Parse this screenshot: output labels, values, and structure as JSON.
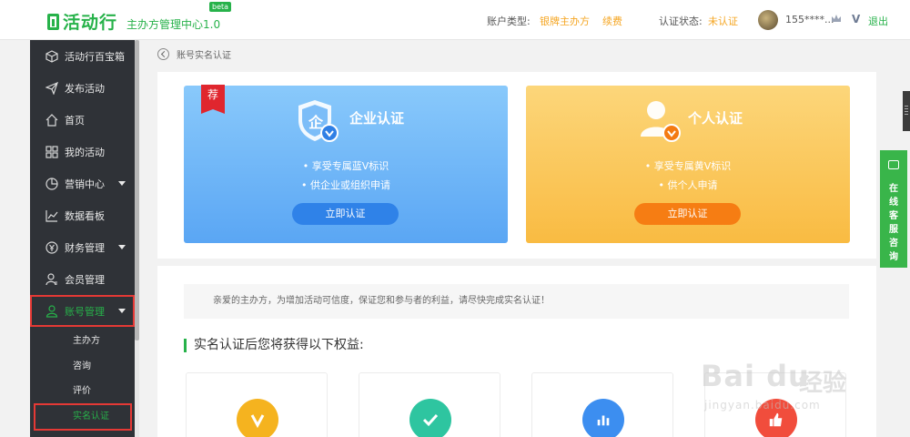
{
  "header": {
    "logo_name": "活动行",
    "logo_sub": "主办方管理中心1.0",
    "beta": "beta",
    "account_type_label": "账户类型:",
    "account_type_value": "银牌主办方",
    "renew": "续费",
    "verify_label": "认证状态:",
    "verify_value": "未认证",
    "phone": "155****...",
    "v_badge": "V",
    "logout": "退出"
  },
  "sidebar": {
    "items": [
      {
        "label": "活动行百宝箱",
        "icon": "cube-icon"
      },
      {
        "label": "发布活动",
        "icon": "paper-plane-icon"
      },
      {
        "label": "首页",
        "icon": "home-icon"
      },
      {
        "label": "我的活动",
        "icon": "grid-icon"
      },
      {
        "label": "营销中心",
        "icon": "pie-chart-icon"
      },
      {
        "label": "数据看板",
        "icon": "line-chart-icon"
      },
      {
        "label": "财务管理",
        "icon": "yen-icon"
      },
      {
        "label": "会员管理",
        "icon": "members-icon"
      },
      {
        "label": "账号管理",
        "icon": "user-icon"
      }
    ],
    "sub_items": [
      {
        "label": "主办方"
      },
      {
        "label": "咨询"
      },
      {
        "label": "评价"
      },
      {
        "label": "实名认证"
      }
    ]
  },
  "breadcrumb": {
    "label": "账号实名认证"
  },
  "cards": {
    "enterprise": {
      "badge": "荐",
      "title": "企业认证",
      "bullets": [
        "享受专属蓝V标识",
        "供企业或组织申请"
      ],
      "button": "立即认证"
    },
    "personal": {
      "title": "个人认证",
      "bullets": [
        "享受专属黄V标识",
        "供个人申请"
      ],
      "button": "立即认证"
    }
  },
  "notice": "亲爱的主办方，为增加活动可信度，保证您和参与者的利益，请尽快完成实名认证！",
  "benefits": {
    "title": "实名认证后您将获得以下权益:",
    "items": [
      {
        "icon": "v-badge-icon",
        "color": "#f5b31f"
      },
      {
        "icon": "check-icon",
        "color": "#2ec5a0"
      },
      {
        "icon": "bar-chart-icon",
        "color": "#3c8ef0"
      },
      {
        "icon": "thumbs-up-icon",
        "color": "#f14d3c"
      }
    ]
  },
  "chat": {
    "label": "在线客服咨询"
  },
  "watermark": {
    "text": "Bai du",
    "cn": "经验",
    "url": "jingyan.baidu.com"
  },
  "colors": {
    "brand_green": "#27b24a",
    "highlight_red": "#e53935",
    "accent_orange": "#f5a623"
  }
}
